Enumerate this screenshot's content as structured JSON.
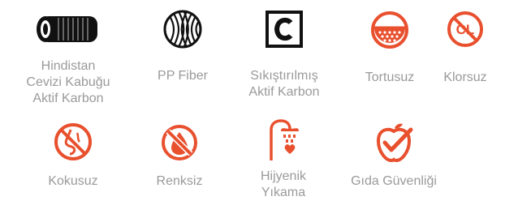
{
  "features": [
    {
      "id": "coconut-carbon",
      "label_lines": [
        "Hindistan",
        "Cevizi Kabuğu",
        "Aktif Karbon"
      ],
      "icon": "carbon-cylinder-icon",
      "color": "#111111"
    },
    {
      "id": "pp-fiber",
      "label_lines": [
        "PP Fiber"
      ],
      "icon": "fiber-ball-icon",
      "color": "#111111"
    },
    {
      "id": "compressed-carbon",
      "label_lines": [
        "Sıkıştırılmış",
        "Aktif Karbon"
      ],
      "icon": "c-block-icon",
      "color": "#111111"
    },
    {
      "id": "sediment-free",
      "label_lines": [
        "Tortusuz"
      ],
      "icon": "sediment-filter-icon",
      "color": "#e8502e"
    },
    {
      "id": "chlorine-free",
      "label_lines": [
        "Klorsuz"
      ],
      "icon": "no-chlorine-icon",
      "color": "#e8502e",
      "icon_text": "CL"
    },
    {
      "id": "odorless",
      "label_lines": [
        "Kokusuz"
      ],
      "icon": "no-odor-icon",
      "color": "#e8502e"
    },
    {
      "id": "colorless",
      "label_lines": [
        "Renksiz"
      ],
      "icon": "no-color-drop-icon",
      "color": "#e8502e"
    },
    {
      "id": "hygienic-wash",
      "label_lines": [
        "Hijyenik",
        "Yıkama"
      ],
      "icon": "shower-heart-icon",
      "color": "#e8502e"
    },
    {
      "id": "food-safety",
      "label_lines": [
        "Gıda Güvenliği"
      ],
      "icon": "apple-check-icon",
      "color": "#e8502e"
    }
  ]
}
